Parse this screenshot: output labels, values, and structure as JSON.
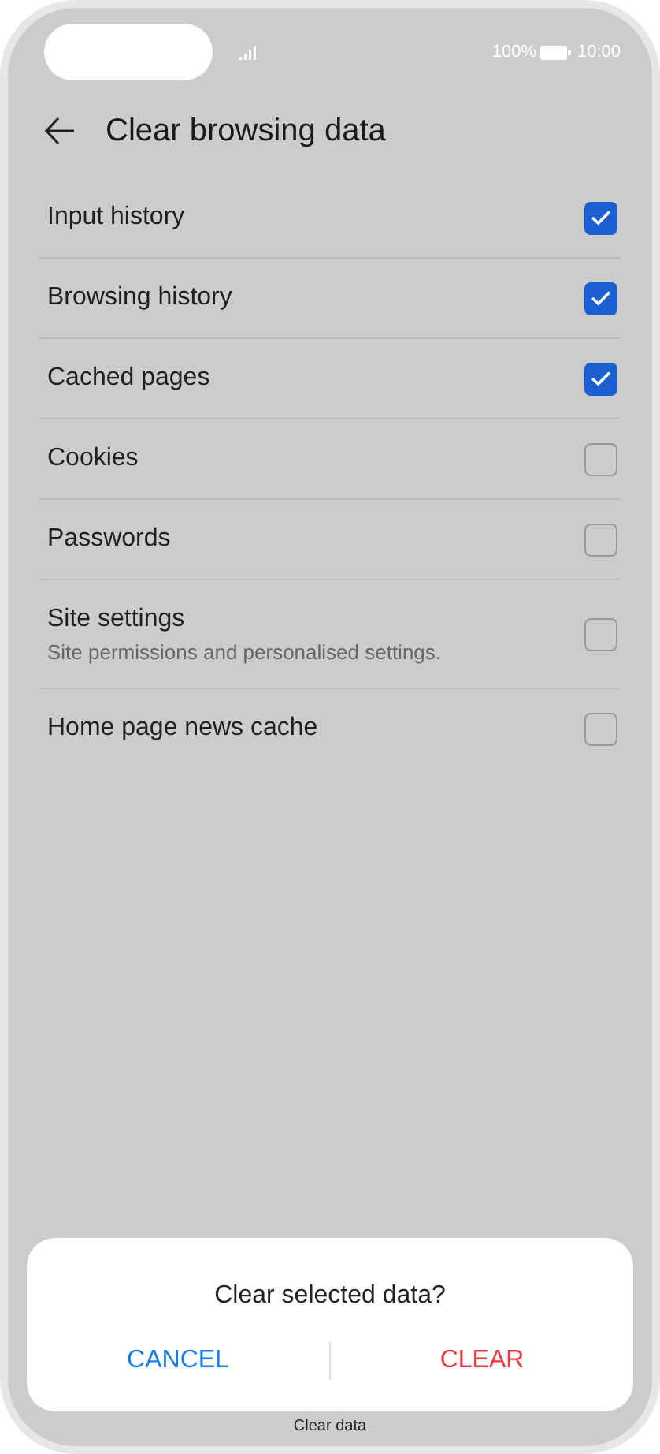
{
  "status_bar": {
    "battery": "100%",
    "time": "10:00"
  },
  "header": {
    "title": "Clear browsing data"
  },
  "options": [
    {
      "label": "Input history",
      "checked": true
    },
    {
      "label": "Browsing history",
      "checked": true
    },
    {
      "label": "Cached pages",
      "checked": true
    },
    {
      "label": "Cookies",
      "checked": false
    },
    {
      "label": "Passwords",
      "checked": false
    },
    {
      "label": "Site settings",
      "description": "Site permissions and personalised settings.",
      "checked": false
    },
    {
      "label": "Home page news cache",
      "checked": false
    }
  ],
  "dialog": {
    "message": "Clear selected data?",
    "buttons": [
      {
        "label": "CANCEL",
        "kind": "cancel"
      },
      {
        "label": "CLEAR",
        "kind": "destructive"
      }
    ]
  },
  "bottom_button": {
    "label": "Clear data"
  }
}
